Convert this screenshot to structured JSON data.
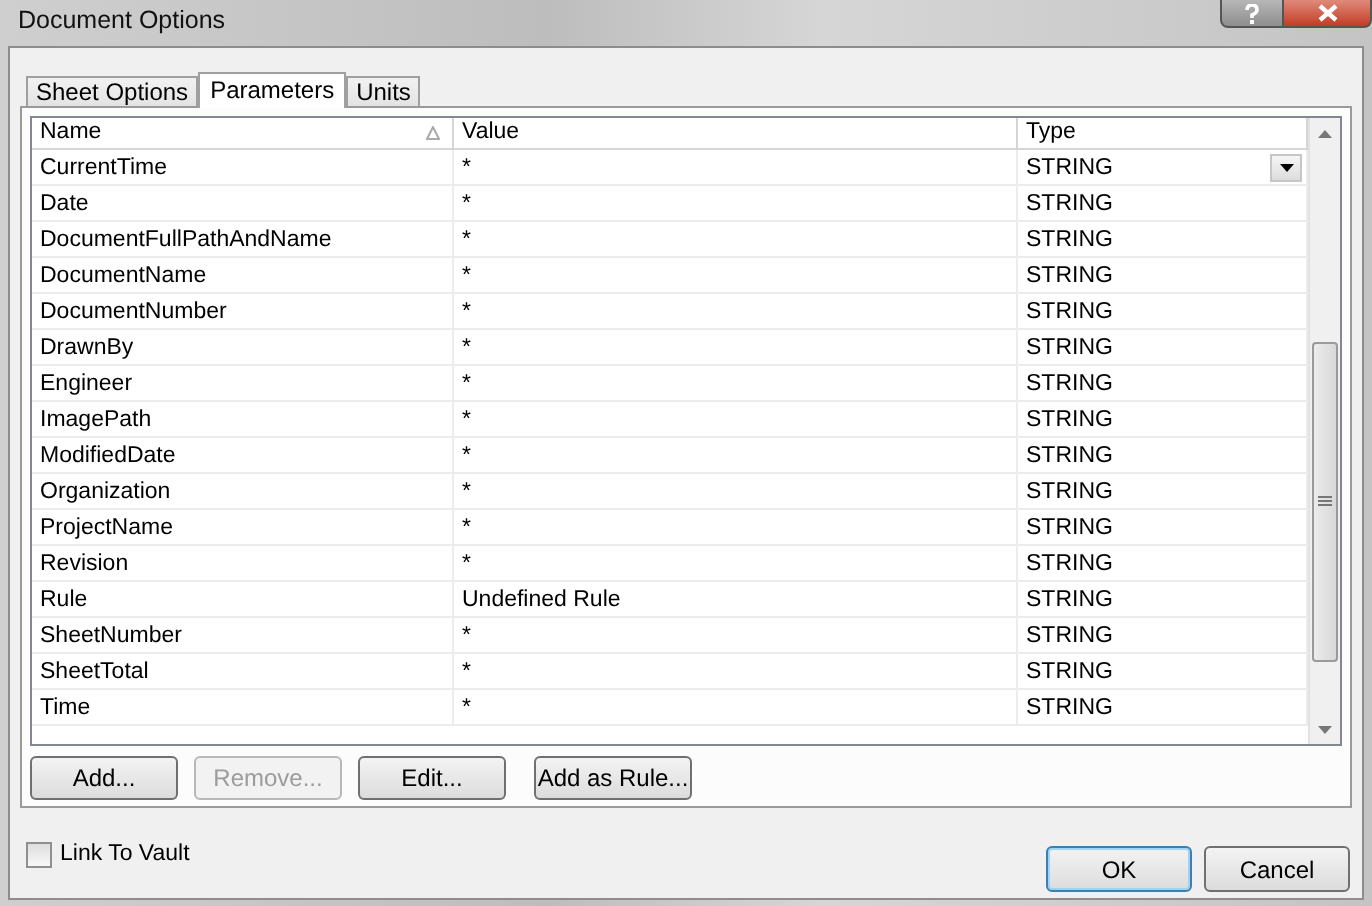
{
  "window": {
    "title": "Document Options"
  },
  "tabs": [
    {
      "label": "Sheet Options",
      "selected": false
    },
    {
      "label": "Parameters",
      "selected": true
    },
    {
      "label": "Units",
      "selected": false
    }
  ],
  "table": {
    "columns": [
      {
        "label": "Name",
        "sorted": true
      },
      {
        "label": "Value",
        "sorted": false
      },
      {
        "label": "Type",
        "sorted": false
      }
    ],
    "rows": [
      {
        "name": "CurrentTime",
        "value": "*",
        "type": "STRING",
        "editing": true
      },
      {
        "name": "Date",
        "value": "*",
        "type": "STRING",
        "editing": false
      },
      {
        "name": "DocumentFullPathAndName",
        "value": "*",
        "type": "STRING",
        "editing": false
      },
      {
        "name": "DocumentName",
        "value": "*",
        "type": "STRING",
        "editing": false
      },
      {
        "name": "DocumentNumber",
        "value": "*",
        "type": "STRING",
        "editing": false
      },
      {
        "name": "DrawnBy",
        "value": "*",
        "type": "STRING",
        "editing": false
      },
      {
        "name": "Engineer",
        "value": "*",
        "type": "STRING",
        "editing": false
      },
      {
        "name": "ImagePath",
        "value": "*",
        "type": "STRING",
        "editing": false
      },
      {
        "name": "ModifiedDate",
        "value": "*",
        "type": "STRING",
        "editing": false
      },
      {
        "name": "Organization",
        "value": "*",
        "type": "STRING",
        "editing": false
      },
      {
        "name": "ProjectName",
        "value": "*",
        "type": "STRING",
        "editing": false
      },
      {
        "name": "Revision",
        "value": "*",
        "type": "STRING",
        "editing": false
      },
      {
        "name": "Rule",
        "value": "Undefined Rule",
        "type": "STRING",
        "editing": false
      },
      {
        "name": "SheetNumber",
        "value": "*",
        "type": "STRING",
        "editing": false
      },
      {
        "name": "SheetTotal",
        "value": "*",
        "type": "STRING",
        "editing": false
      },
      {
        "name": "Time",
        "value": "*",
        "type": "STRING",
        "editing": false
      }
    ]
  },
  "table_buttons": [
    {
      "label": "Add...",
      "disabled": false
    },
    {
      "label": "Remove...",
      "disabled": true
    },
    {
      "label": "Edit...",
      "disabled": false
    },
    {
      "label": "Add as Rule...",
      "disabled": false
    }
  ],
  "link_to_vault": {
    "label": "Link To Vault",
    "checked": false
  },
  "dialog_buttons": [
    {
      "label": "OK",
      "default": true
    },
    {
      "label": "Cancel",
      "default": false
    }
  ]
}
